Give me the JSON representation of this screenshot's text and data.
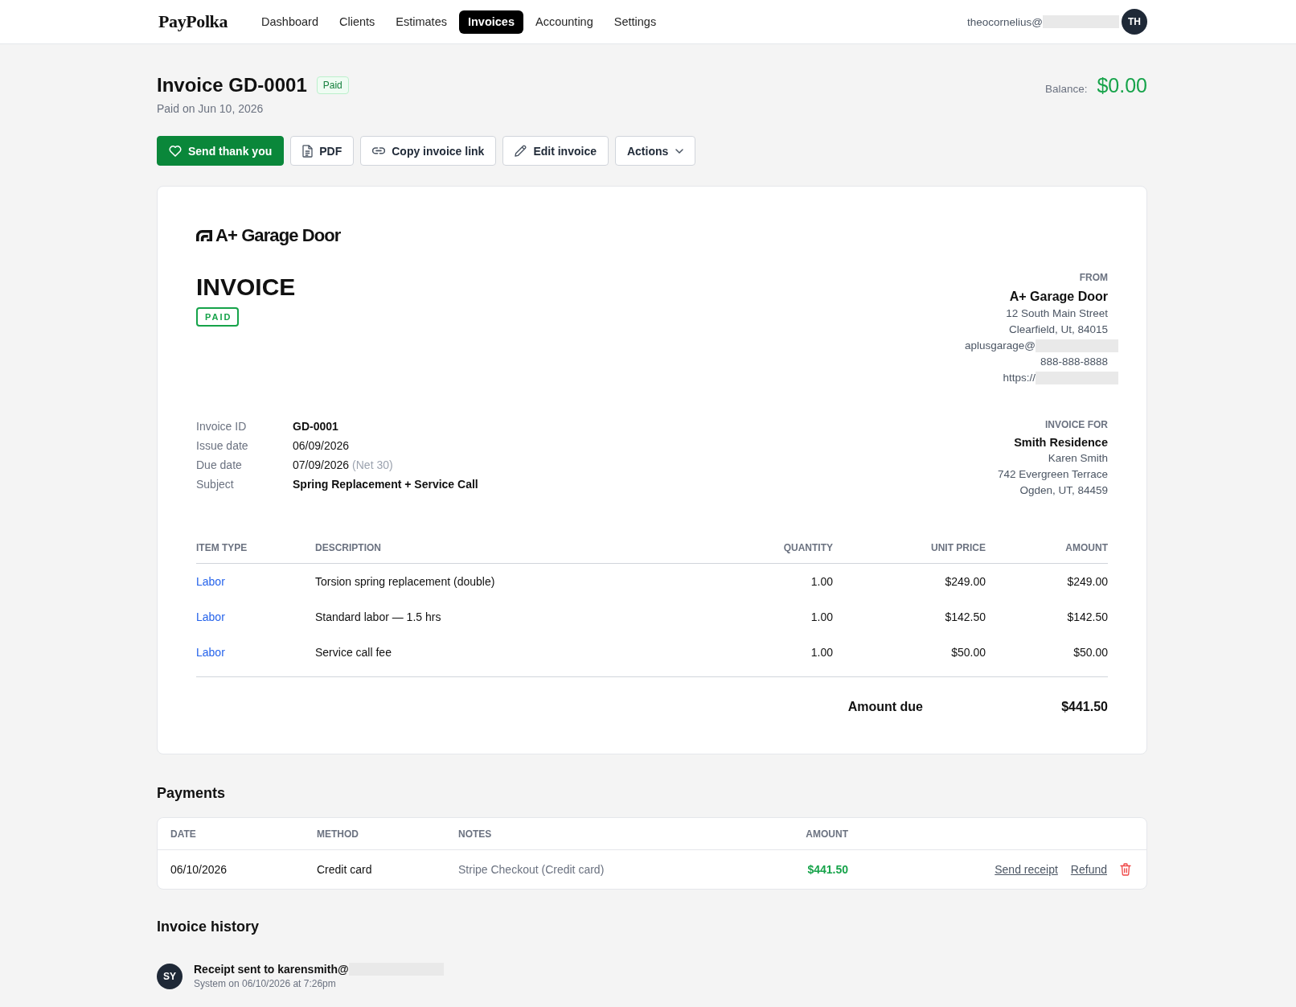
{
  "nav": {
    "logo": "PayPolka",
    "items": [
      {
        "label": "Dashboard",
        "selected": false
      },
      {
        "label": "Clients",
        "selected": false
      },
      {
        "label": "Estimates",
        "selected": false
      },
      {
        "label": "Invoices",
        "selected": true
      },
      {
        "label": "Accounting",
        "selected": false
      },
      {
        "label": "Settings",
        "selected": false
      }
    ],
    "user": {
      "email": "theocornelius@",
      "redacted": true,
      "initials": "TH"
    }
  },
  "page_header": {
    "title": "Invoice GD-0001",
    "badge": "Paid",
    "subtitle": "Paid on Jun 10, 2026",
    "balance_label": "Balance:",
    "balance": "$0.00"
  },
  "actions": [
    {
      "label": "Send thank you",
      "kind": "thank",
      "primary": true
    },
    {
      "label": "PDF",
      "kind": "pdf",
      "primary": false
    },
    {
      "label": "Copy invoice link",
      "kind": "link",
      "primary": false
    },
    {
      "label": "Edit invoice",
      "kind": "edit",
      "primary": false
    },
    {
      "label": "Actions",
      "kind": "menu",
      "primary": false
    }
  ],
  "invoice": {
    "company": "A+ Garage Door",
    "doc_title": "INVOICE",
    "stamp": "PAID",
    "from": {
      "heading": "FROM",
      "name": "A+ Garage Door",
      "lines": [
        {
          "text": "12 South Main Street",
          "redacted": false
        },
        {
          "text": "Clearfield, Ut, 84015",
          "redacted": false
        },
        {
          "text": "aplusgarage@",
          "redacted": true
        },
        {
          "text": "888-888-8888",
          "redacted": false
        },
        {
          "text": "https://",
          "redacted": true
        }
      ]
    },
    "details": [
      {
        "label": "Invoice ID",
        "value": "GD-0001",
        "bold": true
      },
      {
        "label": "Issue date",
        "value": "06/09/2026",
        "bold": false
      },
      {
        "label": "Due date",
        "value": "07/09/2026",
        "note": "(Net 30)",
        "bold": false
      },
      {
        "label": "Subject",
        "value": "Spring Replacement + Service Call",
        "bold": true
      }
    ],
    "bill_to": {
      "heading": "INVOICE FOR",
      "name": "Smith Residence",
      "lines": [
        "Karen Smith",
        "742 Evergreen Terrace",
        "Ogden, UT, 84459"
      ]
    },
    "items": {
      "columns": [
        "ITEM TYPE",
        "DESCRIPTION",
        "QUANTITY",
        "UNIT PRICE",
        "AMOUNT"
      ],
      "rows": [
        {
          "item_type": "Labor",
          "description": "Torsion spring replacement (double)",
          "quantity": "1.00",
          "unit_price": "$249.00",
          "amount": "$249.00"
        },
        {
          "item_type": "Labor",
          "description": "Standard labor — 1.5 hrs",
          "quantity": "1.00",
          "unit_price": "$142.50",
          "amount": "$142.50"
        },
        {
          "item_type": "Labor",
          "description": "Service call fee",
          "quantity": "1.00",
          "unit_price": "$50.00",
          "amount": "$50.00"
        }
      ]
    },
    "total": {
      "label": "Amount due",
      "value": "$441.50"
    }
  },
  "payments": {
    "title": "Payments",
    "columns": [
      "DATE",
      "METHOD",
      "NOTES",
      "AMOUNT"
    ],
    "rows": [
      {
        "date": "06/10/2026",
        "method": "Credit card",
        "notes": "Stripe Checkout (Credit card)",
        "amount": "$441.50",
        "links": [
          "Send receipt",
          "Refund"
        ]
      }
    ]
  },
  "history": {
    "title": "Invoice history",
    "entries": [
      {
        "initials": "SY",
        "text": "Receipt sent to karensmith@",
        "redacted": true,
        "meta": "System on 06/10/2026 at 7:26pm"
      }
    ]
  }
}
